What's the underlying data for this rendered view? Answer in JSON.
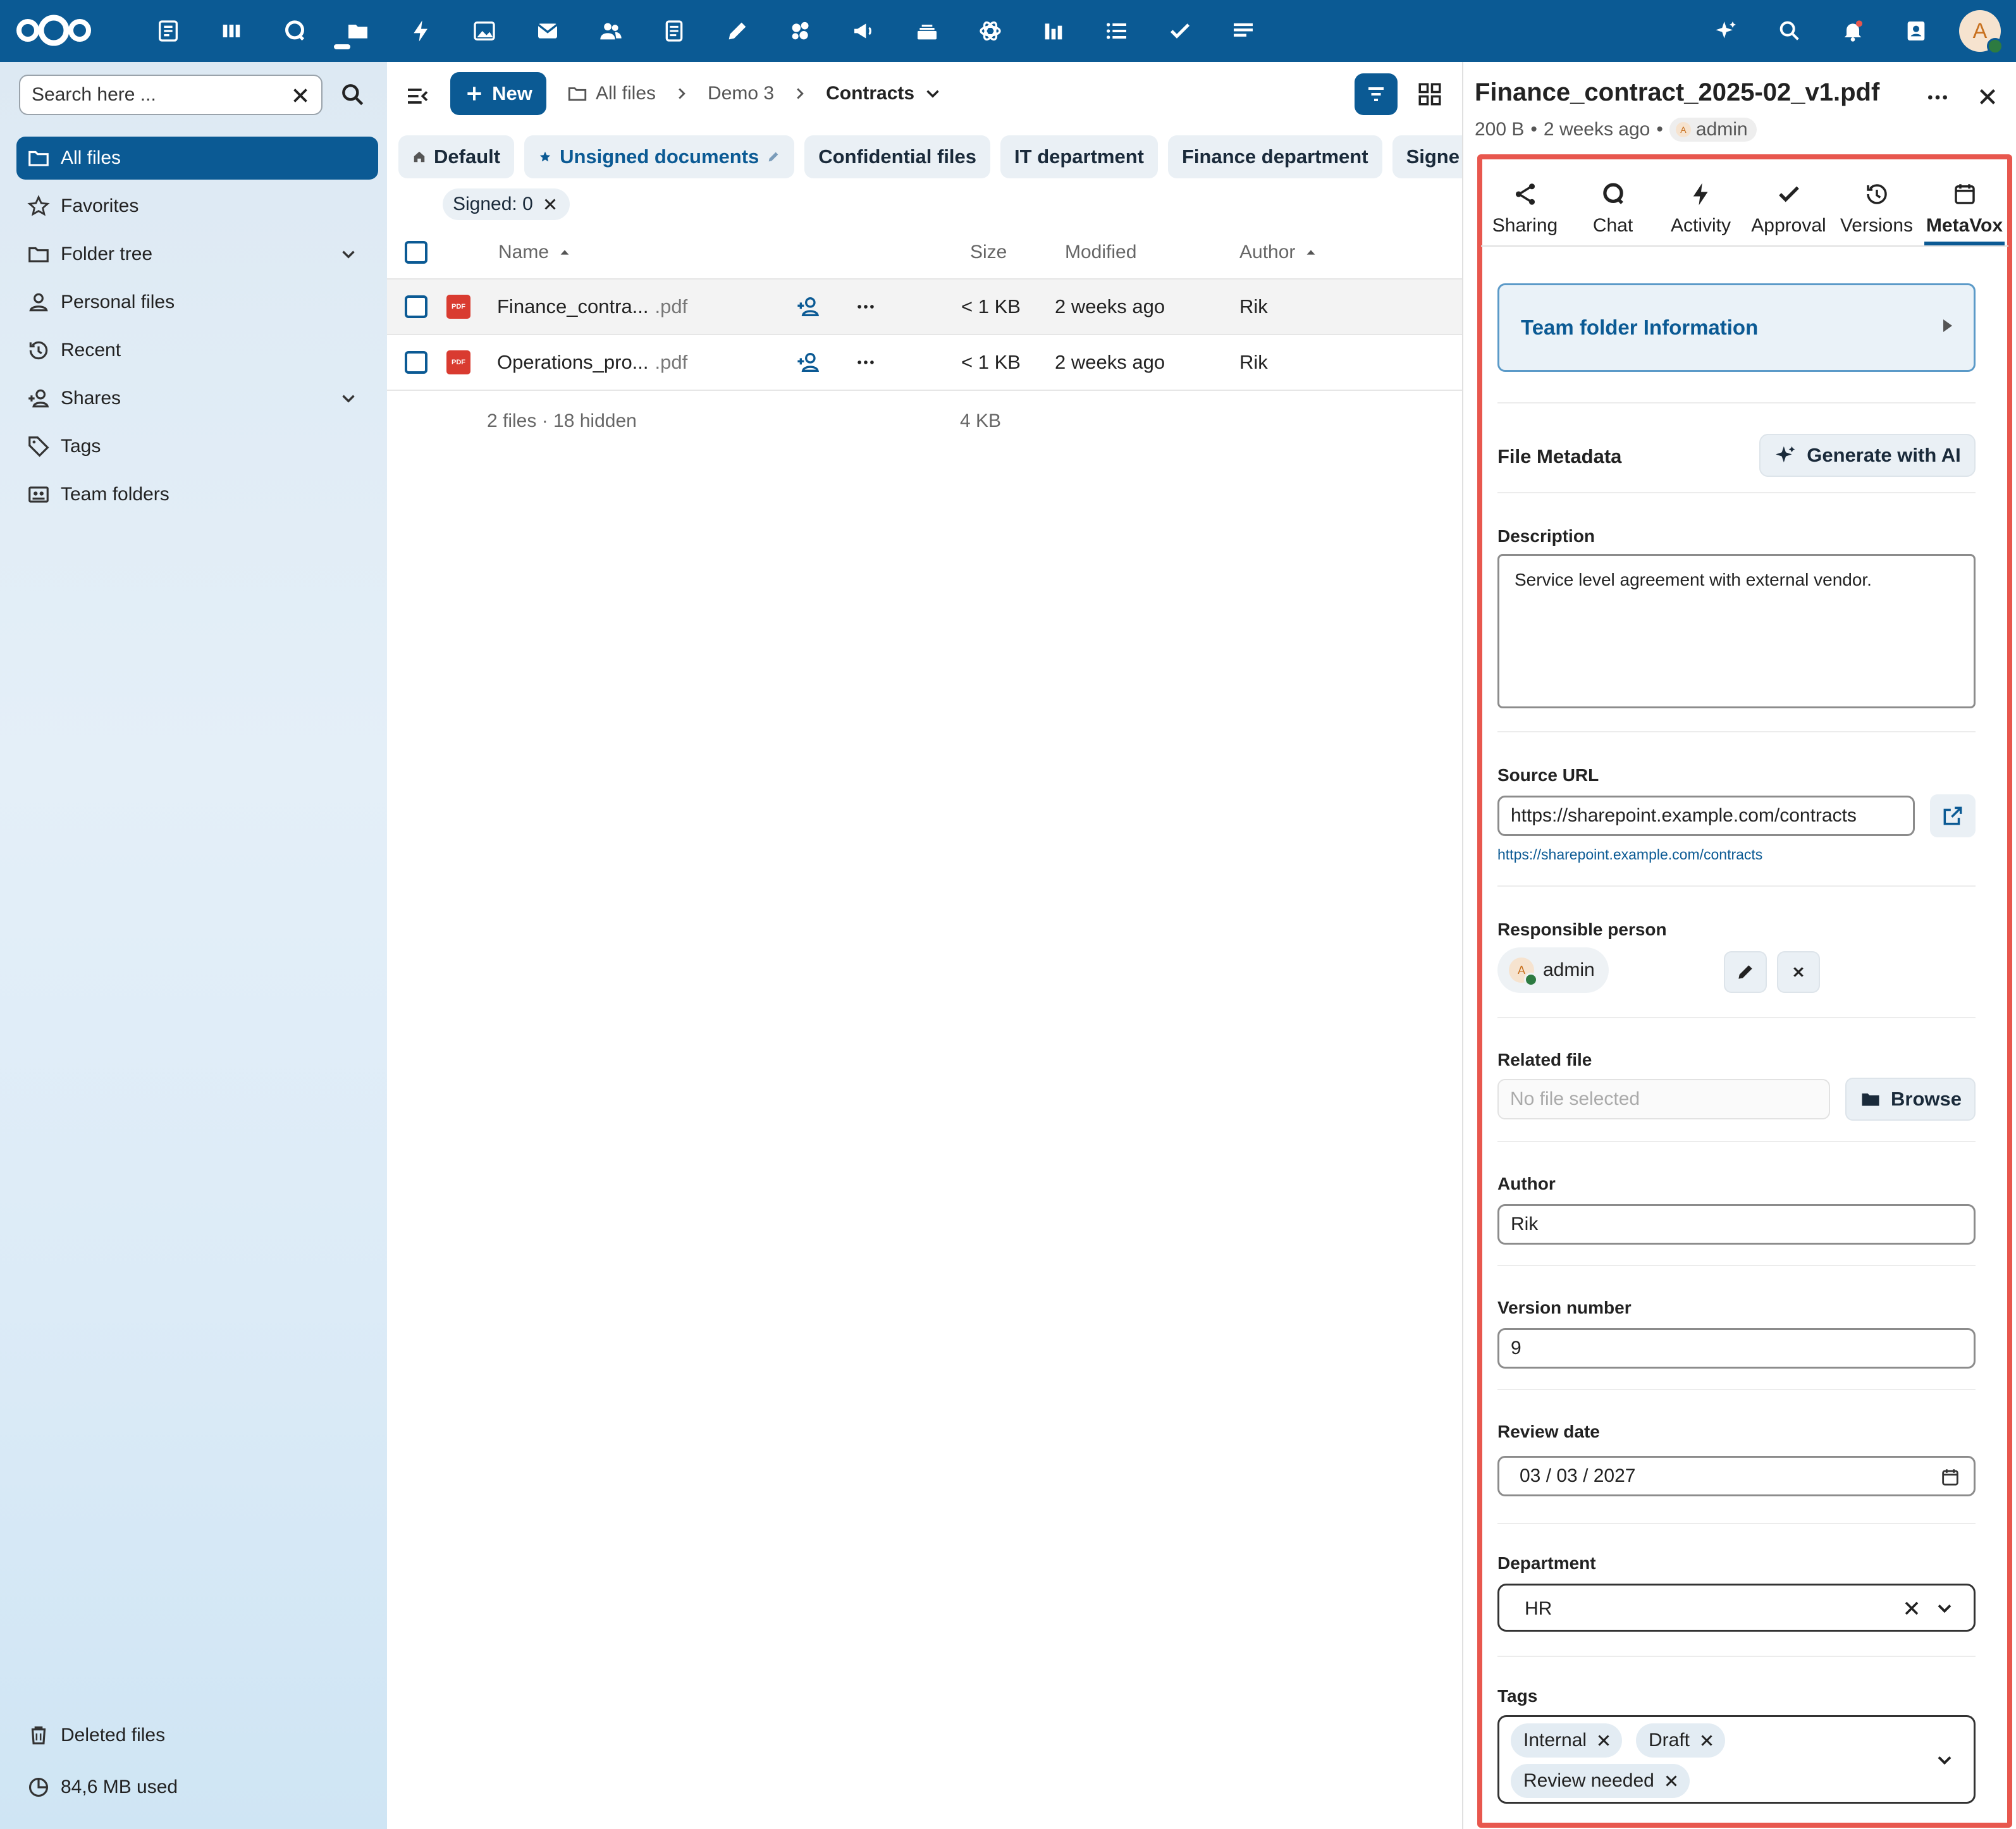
{
  "topbar": {
    "apps": [
      "dashboard",
      "deck",
      "talk",
      "files",
      "activity",
      "photos",
      "mail",
      "contacts",
      "text",
      "draw",
      "collectives",
      "announcements",
      "storage",
      "integrations",
      "analytics",
      "list",
      "tasks",
      "notes"
    ],
    "right_icons": [
      "assistant",
      "search",
      "notifications",
      "contacts-menu"
    ],
    "avatar_letter": "A"
  },
  "sidebar": {
    "search_placeholder": "Search here ...",
    "items": [
      {
        "label": "All files",
        "icon": "folder-icon"
      },
      {
        "label": "Favorites",
        "icon": "star-icon"
      },
      {
        "label": "Folder tree",
        "icon": "folder-icon"
      },
      {
        "label": "Personal files",
        "icon": "user-icon"
      },
      {
        "label": "Recent",
        "icon": "history-icon"
      },
      {
        "label": "Shares",
        "icon": "share-icon"
      },
      {
        "label": "Tags",
        "icon": "tag-icon"
      },
      {
        "label": "Team folders",
        "icon": "team-folder-icon"
      }
    ],
    "bottom": {
      "deleted": "Deleted files",
      "usage": "84,6 MB used"
    }
  },
  "toolbar": {
    "new_label": "New",
    "breadcrumbs": [
      "All files",
      "Demo 3",
      "Contracts"
    ]
  },
  "views": [
    {
      "label": "Default",
      "icon": "home-icon"
    },
    {
      "label": "Unsigned documents",
      "icon": "star-icon"
    },
    {
      "label": "Confidential files"
    },
    {
      "label": "IT department"
    },
    {
      "label": "Finance department"
    },
    {
      "label": "Signe"
    }
  ],
  "active_filter": "Signed: 0",
  "table": {
    "headers": {
      "name": "Name",
      "size": "Size",
      "modified": "Modified",
      "author": "Author"
    },
    "rows": [
      {
        "name": "Finance_contra...",
        "ext": ".pdf",
        "size": "< 1 KB",
        "modified": "2 weeks ago",
        "author": "Rik"
      },
      {
        "name": "Operations_pro...",
        "ext": ".pdf",
        "size": "< 1 KB",
        "modified": "2 weeks ago",
        "author": "Rik"
      }
    ],
    "summary": {
      "count": "2 files · 18 hidden",
      "size": "4 KB"
    },
    "pdf_badge": "PDF"
  },
  "details": {
    "title": "Finance_contract_2025-02_v1.pdf",
    "size": "200 B",
    "time": "2 weeks ago",
    "owner": "admin",
    "owner_initial": "A",
    "tabs": [
      "Sharing",
      "Chat",
      "Activity",
      "Approval",
      "Versions",
      "MetaVox"
    ],
    "team_folder_info": "Team folder Information",
    "metadata_title": "File Metadata",
    "ai_button": "Generate with AI",
    "fields": {
      "description_label": "Description",
      "description_value": "Service level agreement with external vendor.",
      "source_url_label": "Source URL",
      "source_url_value": "https://sharepoint.example.com/contracts",
      "source_url_link": "https://sharepoint.example.com/contracts",
      "responsible_label": "Responsible person",
      "responsible_value": "admin",
      "related_label": "Related file",
      "related_placeholder": "No file selected",
      "browse": "Browse",
      "author_label": "Author",
      "author_value": "Rik",
      "version_label": "Version number",
      "version_value": "9",
      "review_label": "Review date",
      "review_value": "03 / 03 / 2027",
      "department_label": "Department",
      "department_value": "HR",
      "tags_label": "Tags",
      "tags": [
        "Internal",
        "Draft",
        "Review needed"
      ]
    }
  },
  "colors": {
    "primary": "#0b5a94",
    "highlight_frame": "#e8574e",
    "pdf": "#d93b30"
  }
}
